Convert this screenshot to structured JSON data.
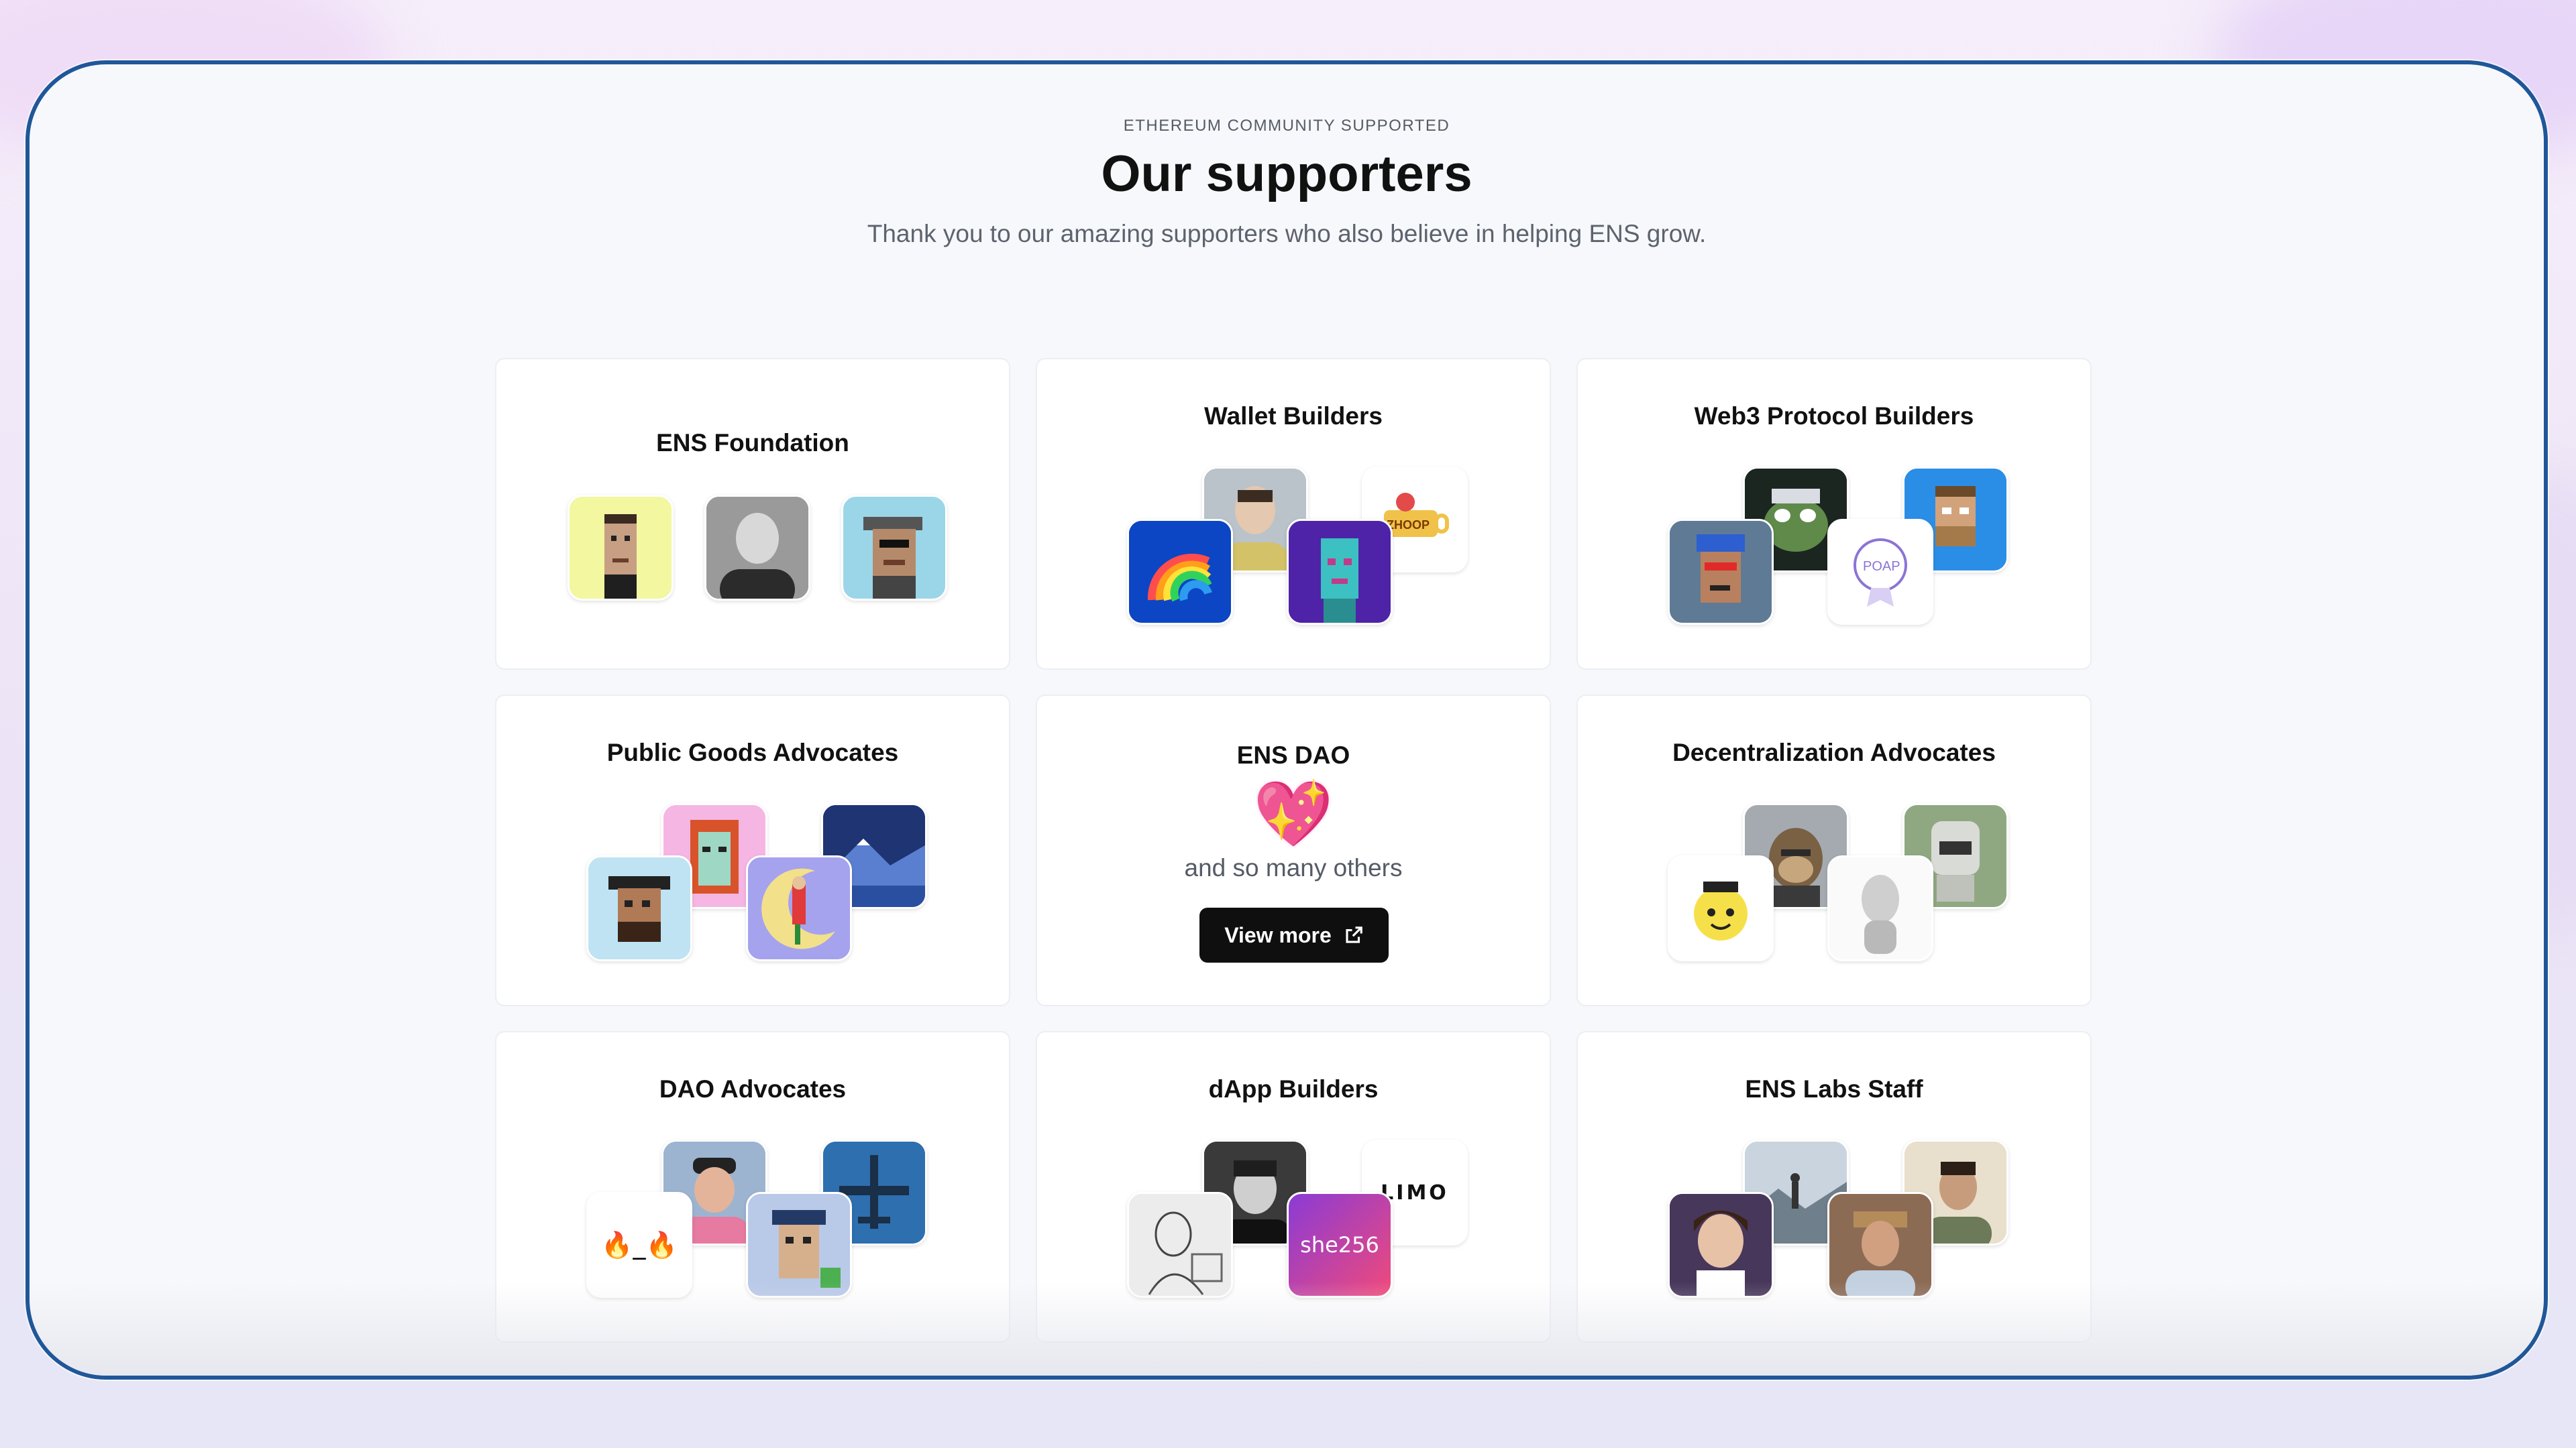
{
  "section": {
    "eyebrow": "ETHEREUM COMMUNITY SUPPORTED",
    "title": "Our supporters",
    "subtitle": "Thank you to our amazing supporters who also believe in helping ENS grow."
  },
  "cards": [
    {
      "title": "ENS Foundation",
      "avatars": [
        "pixel-punk-yellow",
        "photo-portrait-bw",
        "pixel-punk-cap"
      ]
    },
    {
      "title": "Wallet Builders",
      "avatars": [
        "rainbow-logo",
        "photo-portrait",
        "pixel-punk-zombie",
        "zhoop-logo"
      ]
    },
    {
      "title": "Web3 Protocol Builders",
      "avatars": [
        "pepe-art",
        "pixel-punk-beard",
        "pixel-punk-blue",
        "poap-logo"
      ]
    },
    {
      "title": "Public Goods Advocates",
      "avatars": [
        "pixel-punk-red-hair",
        "mountain-art",
        "pixel-punk-hat",
        "dragon-rider-art"
      ]
    },
    {
      "title": "ENS DAO",
      "heart": "💖",
      "others": "and so many others",
      "button_label": "View more"
    },
    {
      "title": "Decentralization Advocates",
      "avatars": [
        "ape-art",
        "robot-art",
        "cartoon-character",
        "marble-bust"
      ]
    },
    {
      "title": "DAO Advocates",
      "avatars": [
        "photo-portrait-cap",
        "airplane-art",
        "fire-emoji-face",
        "pixel-punk-hat-green"
      ],
      "fire_face": "🔥_🔥"
    },
    {
      "title": "dApp Builders",
      "avatars": [
        "photo-portrait-bw",
        "limo-logo",
        "sketch-portrait",
        "she256-logo"
      ],
      "limo_text": "LIMO",
      "she_text": "she256"
    },
    {
      "title": "ENS Labs Staff",
      "avatars": [
        "landscape-photo",
        "photo-portrait",
        "illustrated-portrait",
        "painted-portrait"
      ]
    }
  ]
}
